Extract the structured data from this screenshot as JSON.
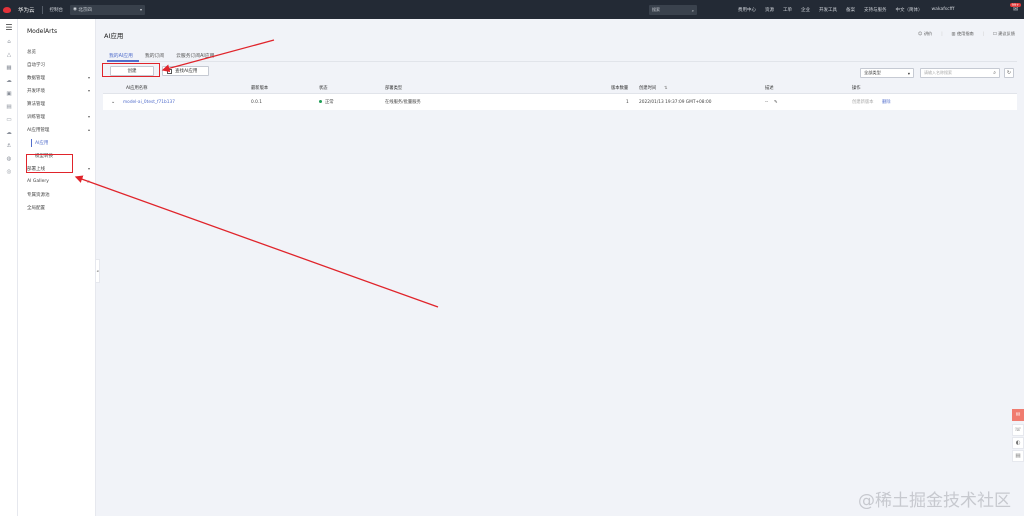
{
  "topbar": {
    "brand": "华为云",
    "console_link": "控制台",
    "region": "北京四",
    "search_placeholder": "搜索",
    "nav": [
      "费用中心",
      "资源",
      "工单",
      "企业",
      "开发工具",
      "备案",
      "支持与服务",
      "中文（简体）",
      "wakafscfff"
    ],
    "badge_count": "99+"
  },
  "sidebar": {
    "title": "ModelArts",
    "items": [
      {
        "label": "总览",
        "arrow": ""
      },
      {
        "label": "自动学习",
        "arrow": ""
      },
      {
        "label": "数据管理",
        "arrow": "▾"
      },
      {
        "label": "开发环境",
        "arrow": "▾"
      },
      {
        "label": "算法管理",
        "arrow": ""
      },
      {
        "label": "训练管理",
        "arrow": "▾"
      },
      {
        "label": "AI应用管理",
        "arrow": "▴"
      }
    ],
    "sub_items": [
      {
        "label": "AI应用"
      },
      {
        "label": "模型转换"
      }
    ],
    "items_after": [
      {
        "label": "部署上线",
        "arrow": "▾"
      },
      {
        "label": "AI Gallery",
        "arrow": "⇗"
      },
      {
        "label": "专属资源池",
        "arrow": ""
      },
      {
        "label": "全局配置",
        "arrow": ""
      }
    ]
  },
  "page": {
    "title": "AI应用",
    "help_label": "讲价",
    "guide_label": "使用指南",
    "feedback_label": "建议反馈",
    "tabs": [
      "我的AI应用",
      "我的订阅",
      "云服务订阅AI应用"
    ],
    "create_button": "创建",
    "checkbox_label": "查找AI应用",
    "filter_value": "全部类型",
    "search_placeholder": "请输入名称搜索"
  },
  "table": {
    "headers": [
      "AI应用名称",
      "最新版本",
      "状态",
      "部署类型",
      "版本数量",
      "创建时间",
      "描述",
      "操作"
    ],
    "rows": [
      {
        "name": "model-ai_0test_f71b137",
        "version": "0.0.1",
        "status": "正常",
        "deploy": "在线服务/批量服务",
        "count": "1",
        "created": "2022/01/13 19:37:09 GMT+08:00",
        "desc": "--",
        "action1": "创建新版本",
        "action2": "删除"
      }
    ]
  },
  "watermark": "@稀土掘金技术社区"
}
